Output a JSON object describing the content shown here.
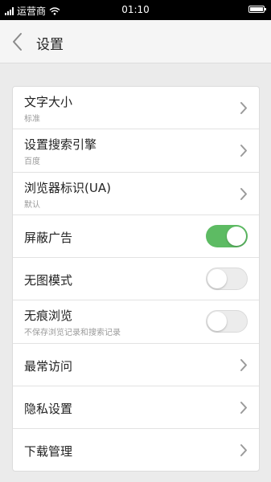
{
  "status_bar": {
    "carrier": "运营商",
    "time": "01:10"
  },
  "header": {
    "title": "设置"
  },
  "settings": [
    {
      "title": "文字大小",
      "subtitle": "标准",
      "control": "chevron"
    },
    {
      "title": "设置搜索引擎",
      "subtitle": "百度",
      "control": "chevron"
    },
    {
      "title": "浏览器标识(UA)",
      "subtitle": "默认",
      "control": "chevron"
    },
    {
      "title": "屏蔽广告",
      "control": "toggle",
      "on": true
    },
    {
      "title": "无图模式",
      "control": "toggle",
      "on": false
    },
    {
      "title": "无痕浏览",
      "subtitle": "不保存浏览记录和搜索记录",
      "control": "toggle",
      "on": false
    },
    {
      "title": "最常访问",
      "control": "chevron"
    },
    {
      "title": "隐私设置",
      "control": "chevron"
    },
    {
      "title": "下载管理",
      "control": "chevron"
    }
  ],
  "colors": {
    "toggle_on": "#5dbb63",
    "toggle_off": "#ececec"
  }
}
